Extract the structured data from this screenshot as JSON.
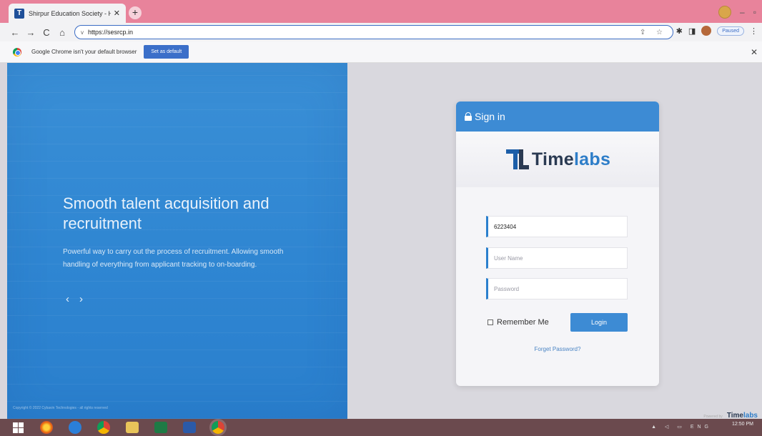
{
  "browser": {
    "tab_title": "Shirpur Education Society - HR I",
    "tab_close": "✕",
    "new_tab": "+",
    "url": "https://sesrcp.in",
    "profile_status": "Paused",
    "nav": {
      "back": "←",
      "forward": "→",
      "reload": "C",
      "home": "⌂"
    },
    "icons": {
      "omnibox": "v",
      "extensions": "✱",
      "sidepanel": "◨",
      "menu": "⋮",
      "share_bookmark": "⇪ ☆"
    }
  },
  "infobar": {
    "message": "Google Chrome isn't your default browser",
    "button": "Set as default",
    "close": "✕"
  },
  "hero": {
    "title": "Smooth talent acquisition and recruitment",
    "subtitle": "Powerful way to carry out the process of recruitment. Allowing smooth handling of everything from applicant tracking to on-boarding.",
    "prev": "‹",
    "next": "›",
    "copyright": "Copyright © 2022 Cybavin Technologies - all rights reserved"
  },
  "login": {
    "header": "Sign in",
    "logo_text_dark": "Time",
    "logo_text_accent": "labs",
    "company_code_value": "6223404",
    "username_placeholder": "User Name",
    "password_placeholder": "Password",
    "remember_label": "Remember Me",
    "login_button": "Login",
    "forgot_link": "Forget Password?"
  },
  "footer": {
    "powered_by": "Powered by",
    "brand_dark": "Time",
    "brand_accent": "labs"
  },
  "taskbar": {
    "tray": "▲ ◁ ▭ ENG",
    "time": "12:50 PM"
  },
  "colors": {
    "hero_blue": "#2f86d2",
    "accent": "#3d8bd4",
    "titlebar": "#e8839b",
    "taskbar": "#6b4a4e"
  }
}
